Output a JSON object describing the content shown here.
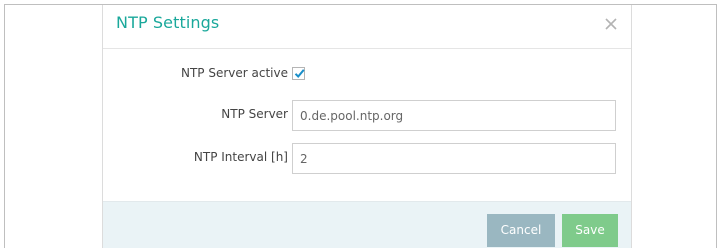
{
  "dialog": {
    "title": "NTP Settings",
    "close_icon": "close-icon"
  },
  "form": {
    "ntp_active": {
      "label": "NTP Server active",
      "checked": true
    },
    "ntp_server": {
      "label": "NTP Server",
      "value": "0.de.pool.ntp.org"
    },
    "ntp_interval": {
      "label": "NTP Interval [h]",
      "value": "2"
    }
  },
  "footer": {
    "cancel_label": "Cancel",
    "save_label": "Save"
  },
  "colors": {
    "title": "#1aa89b",
    "checkmark": "#1a8fc9",
    "cancel_button": "#9ab7c1",
    "save_button": "#7fcb8b",
    "footer_bg": "#eaf3f6"
  }
}
